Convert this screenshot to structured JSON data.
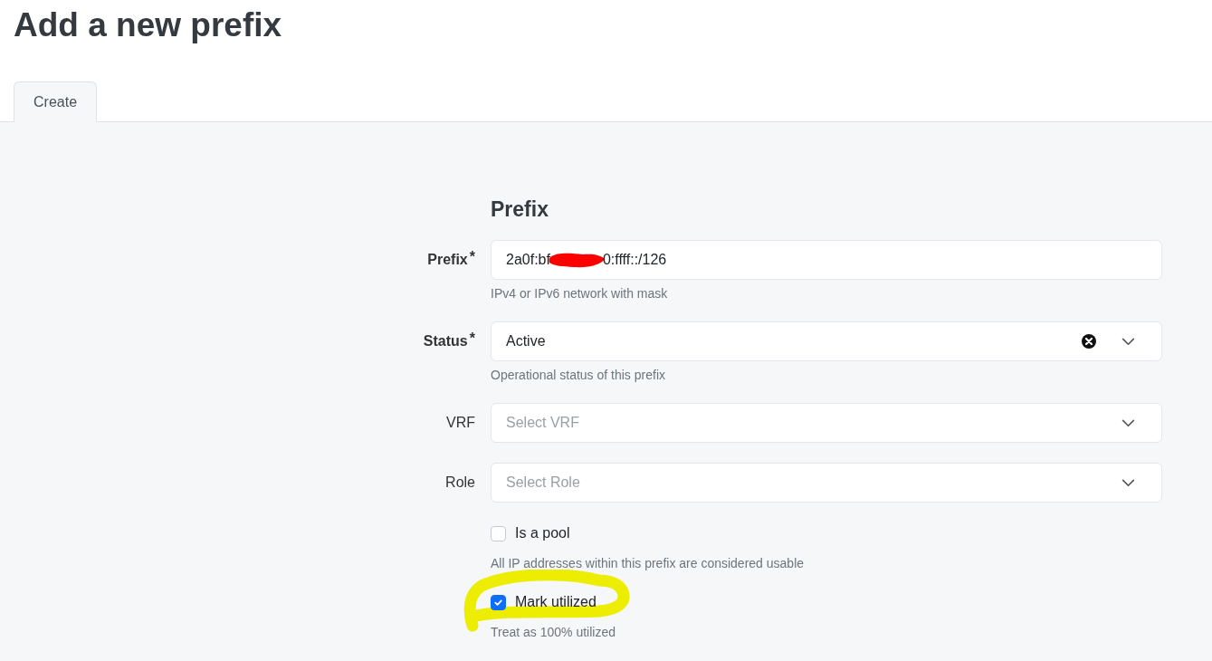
{
  "title": "Add a new prefix",
  "tabs": [
    {
      "label": "Create",
      "selected": true
    }
  ],
  "section": {
    "heading": "Prefix"
  },
  "fields": [
    {
      "kind": "text",
      "label": "Prefix",
      "required_mark": "*",
      "value_parts": [
        "2a0f:bf",
        "0:ffff::/126"
      ],
      "redacted": true,
      "help": "IPv4 or IPv6 network with mask"
    },
    {
      "kind": "select",
      "label": "Status",
      "required_mark": "*",
      "value": "Active",
      "clearable": true,
      "help": "Operational status of this prefix"
    },
    {
      "kind": "select",
      "label": "VRF",
      "placeholder": "Select VRF"
    },
    {
      "kind": "select",
      "label": "Role",
      "placeholder": "Select Role"
    },
    {
      "kind": "checkbox",
      "label": "Is a pool",
      "checked": false,
      "help": "All IP addresses within this prefix are considered usable"
    },
    {
      "kind": "checkbox",
      "label": "Mark utilized",
      "checked": true,
      "highlighted": true,
      "help": "Treat as 100% utilized"
    }
  ]
}
